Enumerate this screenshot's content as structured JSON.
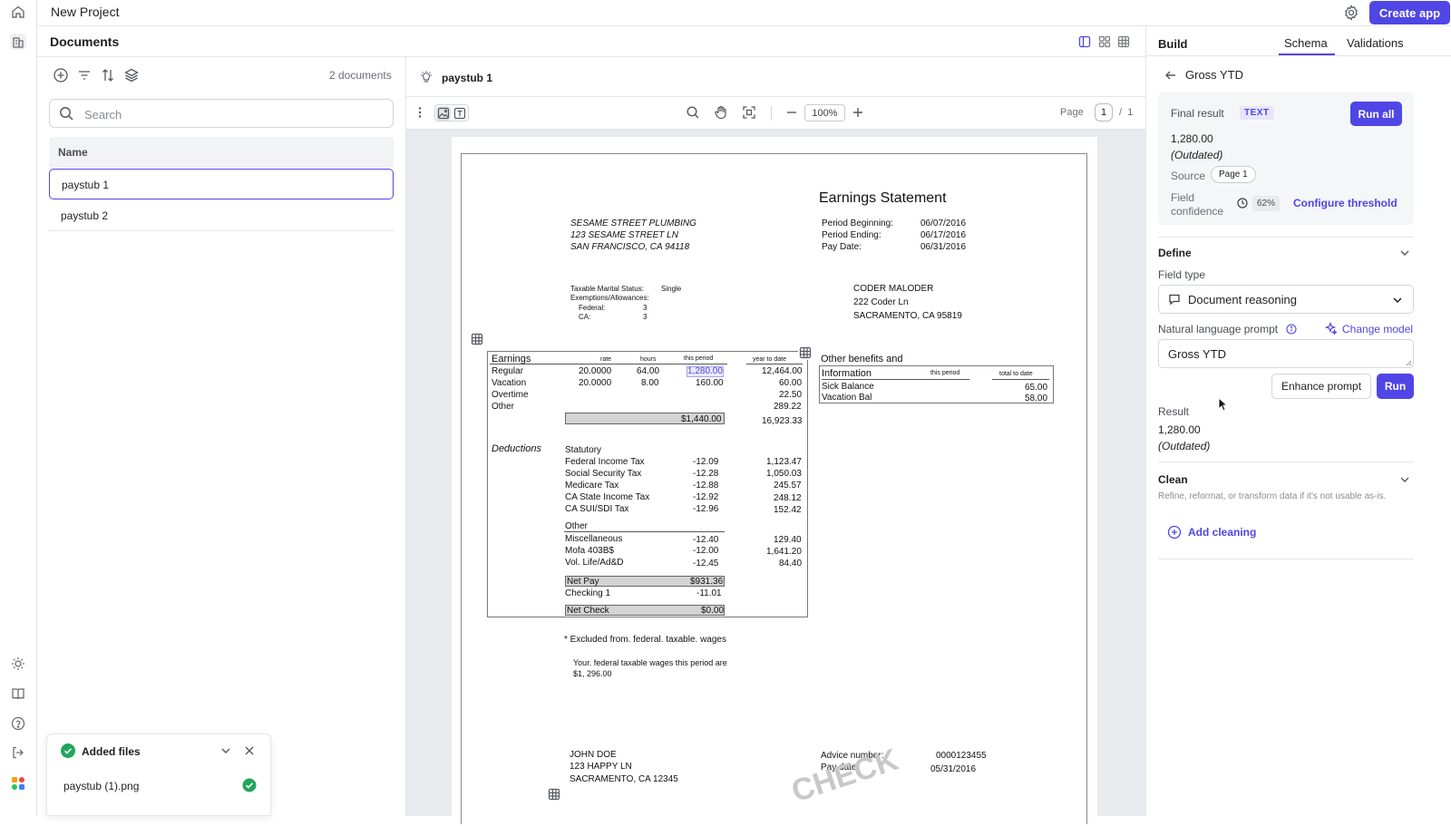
{
  "app": {
    "project_title": "New Project",
    "create_app_label": "Create app"
  },
  "left_panel": {
    "title": "Documents",
    "doc_count": "2 documents",
    "search_placeholder": "Search",
    "column_header": "Name",
    "documents": [
      {
        "name": "paystub 1",
        "selected": true
      },
      {
        "name": "paystub 2",
        "selected": false
      }
    ],
    "added_files": {
      "title": "Added files",
      "files": [
        {
          "name": "paystub (1).png",
          "status": "done"
        }
      ]
    }
  },
  "viewer": {
    "doc_title": "paystub 1",
    "zoom": "100%",
    "page_label": "Page",
    "page_current": "1",
    "page_sep": "/",
    "page_total": "1"
  },
  "paystub": {
    "title": "Earnings Statement",
    "company": [
      "SESAME STREET PLUMBING",
      "123 SESAME STREET LN",
      "SAN FRANCISCO, CA 94118"
    ],
    "period_labels": [
      "Period Beginning:",
      "Period Ending:",
      "Pay Date:"
    ],
    "period_values": [
      "06/07/2016",
      "06/17/2016",
      "06/31/2016"
    ],
    "tax_status": {
      "marital_label": "Taxable Marital Status:",
      "marital_value": "Single",
      "exemptions_label": "Exemptions/Allowances:",
      "federal_label": "Federal:",
      "federal_value": "3",
      "ca_label": "CA:",
      "ca_value": "3"
    },
    "employee": [
      "CODER MALODER",
      "222 Coder Ln",
      "SACRAMENTO, CA 95819"
    ],
    "earnings_header": {
      "title": "Earnings",
      "rate": "rate",
      "hours": "hours",
      "this_period": "this period",
      "ytd": "year  to  date"
    },
    "earnings": [
      {
        "label": "Regular",
        "rate": "20.0000",
        "hours": "64.00",
        "period": "1,280.00",
        "ytd": "12,464.00"
      },
      {
        "label": "Vacation",
        "rate": "20.0000",
        "hours": "8.00",
        "period": "160.00",
        "ytd": "60.00"
      },
      {
        "label": "Overtime",
        "rate": "",
        "hours": "",
        "period": "",
        "ytd": "22.50"
      },
      {
        "label": "Other",
        "rate": "",
        "hours": "",
        "period": "",
        "ytd": "289.22"
      }
    ],
    "gross_total": "$1,440.00",
    "gross_ytd": "16,923.33",
    "deductions_title": "Deductions",
    "statutory_label": "Statutory",
    "statutory": [
      {
        "label": "Federal  Income Tax",
        "period": "-12.09",
        "ytd": "1,123.47"
      },
      {
        "label": "Social  Security  Tax",
        "period": "-12.28",
        "ytd": "1,050.03"
      },
      {
        "label": "Medicare Tax",
        "period": "-12.88",
        "ytd": "245.57"
      },
      {
        "label": "CA  State  Income Tax",
        "period": "-12.92",
        "ytd": "248.12"
      },
      {
        "label": "CA SUI/SDI  Tax",
        "period": "-12.96",
        "ytd": "152.42"
      }
    ],
    "other_label": "Other",
    "other": [
      {
        "label": "Miscellaneous",
        "period": "-12.40",
        "ytd": "129.40"
      },
      {
        "label": "Mofa 403B$",
        "period": "-12.00",
        "ytd": "1,641.20"
      },
      {
        "label": "Vol. Life/Ad&D",
        "period": "-12.45",
        "ytd": "84.40"
      }
    ],
    "net_pay_label": "Net Pay",
    "net_pay": "$931.36",
    "checking_label": "Checking 1",
    "checking": "-11.01",
    "net_check_label": "Net Check",
    "net_check": "$0.00",
    "benefits": {
      "title_line1": "Other benefits and",
      "title_line2": "Information",
      "this_period": "this period",
      "ytd": "total  to  date",
      "rows": [
        {
          "label": "Sick Balance",
          "value": "65.00"
        },
        {
          "label": "Vacation Bal",
          "value": "58.00"
        }
      ]
    },
    "note1": "*   Excluded  from.  federal.  taxable.  wages",
    "note2a": "Your.  federal  taxable  wages  this  period  are",
    "note2b": "$1, 296.00",
    "recipient": [
      "JOHN DOE",
      "123 HAPPY LN",
      "SACRAMENTO, CA 12345"
    ],
    "advice_label": "Advice number:",
    "advice_value": "0000123455",
    "paydate_label": "Pay date:",
    "paydate_value": "05/31/2016",
    "watermark": "CHECK"
  },
  "right_panel": {
    "title": "Build",
    "tabs": [
      {
        "label": "Schema",
        "active": true
      },
      {
        "label": "Validations",
        "active": false
      }
    ],
    "field_name": "Gross YTD",
    "final_result_label": "Final result",
    "type_badge": "TEXT",
    "run_all_label": "Run all",
    "final_value": "1,280.00",
    "final_status": "(Outdated)",
    "source_label": "Source",
    "source_value": "Page 1",
    "confidence_label_1": "Field",
    "confidence_label_2": "confidence",
    "confidence_value": "62%",
    "configure_link": "Configure threshold",
    "define_title": "Define",
    "field_type_label": "Field type",
    "field_type_value": "Document reasoning",
    "prompt_label": "Natural language prompt",
    "change_model_label": "Change model",
    "prompt_value": "Gross YTD",
    "enhance_label": "Enhance prompt",
    "run_label": "Run",
    "result_label": "Result",
    "result_value": "1,280.00",
    "result_status": "(Outdated)",
    "clean_title": "Clean",
    "clean_desc": "Refine, reformat, or transform data if it's not usable as-is.",
    "add_cleaning_label": "Add cleaning"
  },
  "colors": {
    "accent": "#4f46e5",
    "success": "#22a55b",
    "border": "#e5e6ea"
  }
}
